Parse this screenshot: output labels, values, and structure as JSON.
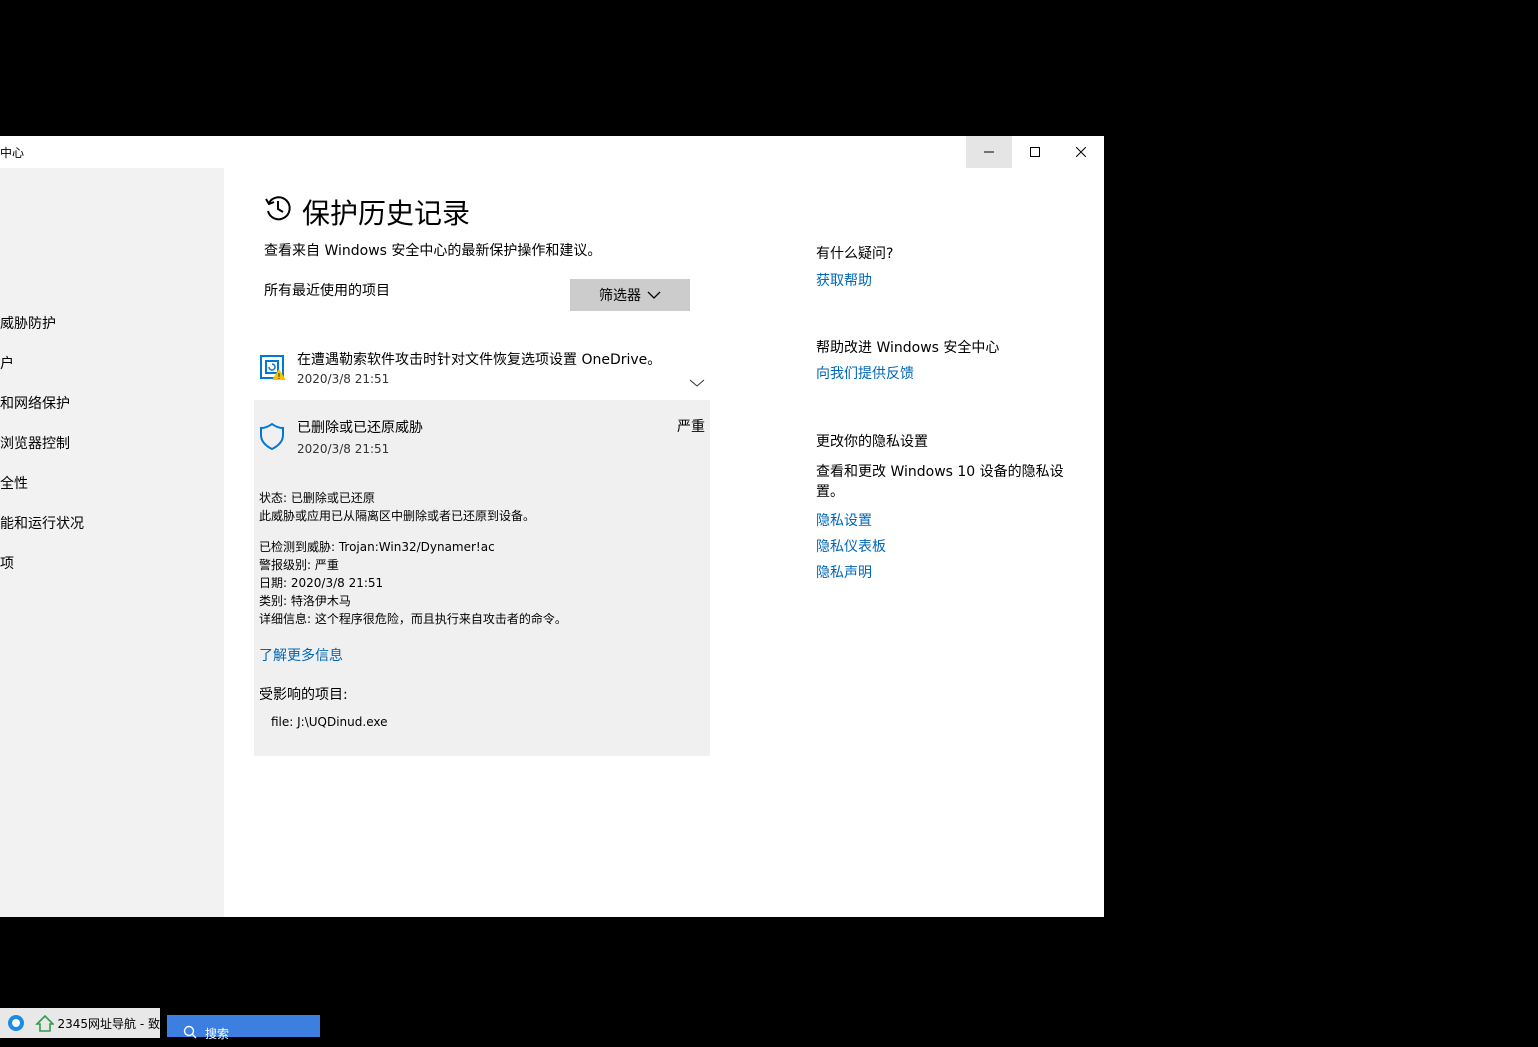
{
  "window": {
    "title": "中心"
  },
  "sidebar": {
    "items": [
      {
        "label": "威胁防护"
      },
      {
        "label": "户"
      },
      {
        "label": "和网络保护"
      },
      {
        "label": "浏览器控制"
      },
      {
        "label": "全性"
      },
      {
        "label": "能和运行状况"
      },
      {
        "label": "项"
      }
    ]
  },
  "main": {
    "title": "保护历史记录",
    "description": "查看来自 Windows 安全中心的最新保护操作和建议。",
    "filter_label": "所有最近使用的项目",
    "filter_button": "筛选器",
    "items": [
      {
        "title": "在遭遇勒索软件攻击时针对文件恢复选项设置 OneDrive。",
        "date": "2020/3/8 21:51"
      },
      {
        "title": "已删除或已还原威胁",
        "date": "2020/3/8 21:51",
        "severity": "严重",
        "status": "状态: 已删除或已还原",
        "status_desc": "此威胁或应用已从隔离区中删除或者已还原到设备。",
        "detected": "已检测到威胁:  Trojan:Win32/Dynamer!ac",
        "alert_level": "警报级别:  严重",
        "date_line": "日期:  2020/3/8 21:51",
        "category": "类别:  特洛伊木马",
        "details": "详细信息:  这个程序很危险，而且执行来自攻击者的命令。",
        "learn_more": "了解更多信息",
        "affected_label": "受影响的项目:",
        "affected_file": "file: J:\\UQDinud.exe"
      }
    ]
  },
  "right": {
    "q_heading": "有什么疑问?",
    "q_link": "获取帮助",
    "improve_heading": "帮助改进 Windows 安全中心",
    "improve_link": "向我们提供反馈",
    "privacy_heading": "更改你的隐私设置",
    "privacy_text": "查看和更改 Windows 10 设备的隐私设置。",
    "privacy_links": [
      "隐私设置",
      "隐私仪表板",
      "隐私声明"
    ]
  },
  "taskbar": {
    "app_label": "2345网址导航 - 致",
    "search_label": "搜索"
  },
  "colors": {
    "link": "#0067b8",
    "sidebar_bg": "#f2f2f2",
    "detail_bg": "#f0f0f0",
    "filter_bg": "#cccccc"
  }
}
